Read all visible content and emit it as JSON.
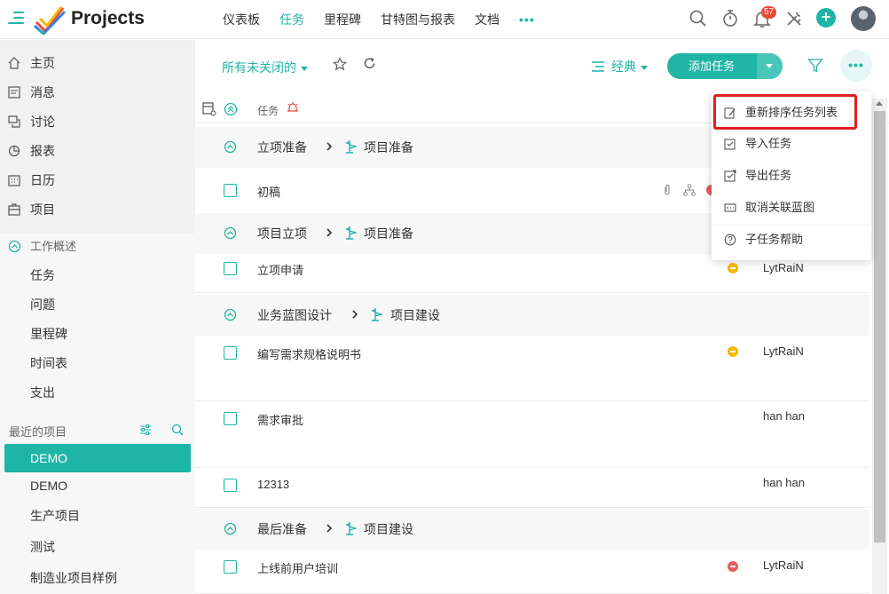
{
  "app": {
    "title": "Projects"
  },
  "nav": {
    "items": [
      {
        "label": "仪表板",
        "active": false
      },
      {
        "label": "任务",
        "active": true
      },
      {
        "label": "里程碑",
        "active": false
      },
      {
        "label": "甘特图与报表",
        "active": false
      },
      {
        "label": "文档",
        "active": false
      }
    ],
    "more": "•••"
  },
  "topbar": {
    "notification_count": "57",
    "icons": [
      "search-icon",
      "timer-icon",
      "bell-icon",
      "tools-icon",
      "add-icon",
      "avatar"
    ]
  },
  "sidebar": {
    "main_items": [
      {
        "label": "主页",
        "icon": "home-icon"
      },
      {
        "label": "消息",
        "icon": "message-icon"
      },
      {
        "label": "讨论",
        "icon": "discussion-icon"
      },
      {
        "label": "报表",
        "icon": "report-icon"
      },
      {
        "label": "日历",
        "icon": "calendar-icon"
      },
      {
        "label": "项目",
        "icon": "project-icon"
      }
    ],
    "work_section": {
      "label": "工作概述"
    },
    "work_items": [
      "任务",
      "问题",
      "里程碑",
      "时间表",
      "支出"
    ],
    "recent_label": "最近的项目",
    "recent_projects": [
      {
        "label": "DEMO",
        "active": true
      },
      {
        "label": "DEMO",
        "active": false
      },
      {
        "label": "生产项目",
        "active": false
      },
      {
        "label": "测试",
        "active": false
      },
      {
        "label": "制造业项目样例",
        "active": false
      }
    ]
  },
  "toolbar": {
    "filter_label": "所有未关闭的",
    "view_label": "经典",
    "add_task_label": "添加任务",
    "more_label": "•••"
  },
  "table": {
    "task_column": "任务"
  },
  "groups": [
    {
      "name": "立项准备",
      "milestone": "项目准备"
    },
    {
      "name": "项目立项",
      "milestone": "项目准备"
    },
    {
      "name": "业务蓝图设计",
      "milestone": "项目建设"
    },
    {
      "name": "最后准备",
      "milestone": "项目建设"
    }
  ],
  "tasks": [
    {
      "name": "初稿",
      "owner": "",
      "priority": ""
    },
    {
      "name": "立项申请",
      "owner": "LytRaiN",
      "priority": "medium"
    },
    {
      "name": "编写需求规格说明书",
      "owner": "LytRaiN",
      "priority": "medium"
    },
    {
      "name": "需求审批",
      "owner": "han han",
      "priority": ""
    },
    {
      "name": "12313",
      "owner": "han han",
      "priority": ""
    },
    {
      "name": "上线前用户培训",
      "owner": "LytRaiN",
      "priority": "high"
    }
  ],
  "dropdown": {
    "items": [
      {
        "label": "重新排序任务列表",
        "icon": "reorder-icon"
      },
      {
        "label": "导入任务",
        "icon": "import-icon"
      },
      {
        "label": "导出任务",
        "icon": "export-icon"
      },
      {
        "label": "取消关联蓝图",
        "icon": "unlink-blueprint-icon"
      },
      {
        "label": "子任务帮助",
        "icon": "help-icon"
      }
    ]
  },
  "colors": {
    "accent": "#1fb5a6",
    "medium_priority": "#f5b800",
    "high_priority": "#e85a5a",
    "highlight": "#e02020"
  }
}
